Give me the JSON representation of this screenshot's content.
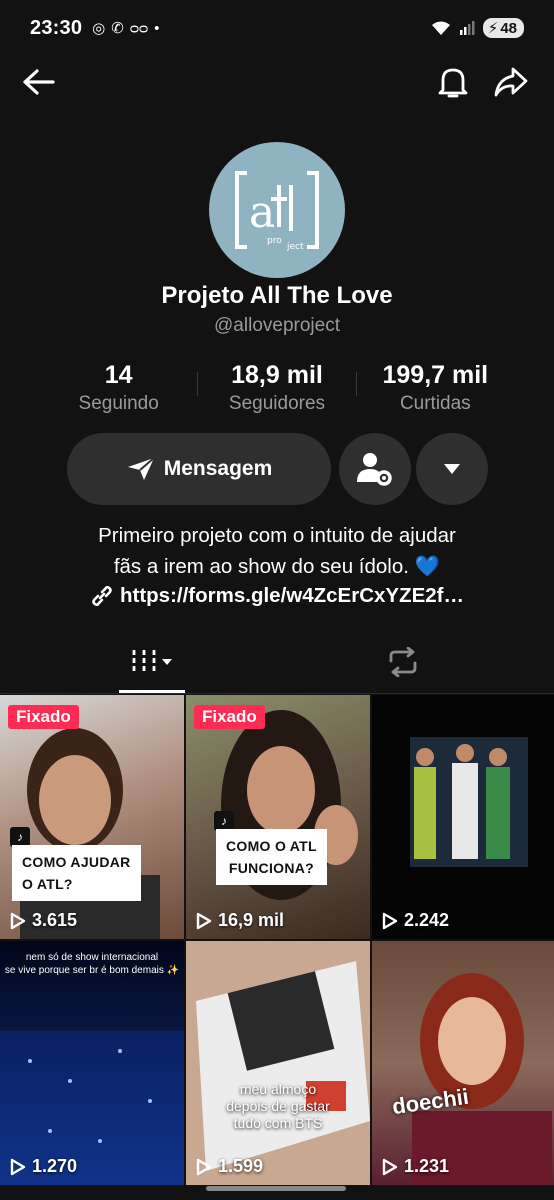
{
  "status_bar": {
    "time": "23:30",
    "battery": "48"
  },
  "profile": {
    "display_name": "Projeto All The Love",
    "username": "@alloveproject",
    "avatar_text": "[atl] project"
  },
  "stats": [
    {
      "value": "14",
      "label": "Seguindo"
    },
    {
      "value": "18,9 mil",
      "label": "Seguidores"
    },
    {
      "value": "199,7 mil",
      "label": "Curtidas"
    }
  ],
  "actions": {
    "message_label": "Mensagem"
  },
  "bio": {
    "line1": "Primeiro projeto com o intuito de ajudar",
    "line2": "fãs a irem ao show do seu ídolo. 💙",
    "link": "https://forms.gle/w4ZcErCxYZE2f…"
  },
  "videos": [
    {
      "pinned": "Fixado",
      "caption": "COMO AJUDAR\nO ATL?",
      "views": "3.615"
    },
    {
      "pinned": "Fixado",
      "caption": "COMO O ATL\nFUNCIONA?",
      "views": "16,9 mil"
    },
    {
      "views": "2.242"
    },
    {
      "overlay": "nem só de show internacional\nse vive porque ser br é bom demais ✨",
      "views": "1.270"
    },
    {
      "overlay": "meu almoço\ndepois de gastar\ntudo com BTS",
      "views": "1.599"
    },
    {
      "overlay": "doechii",
      "views": "1.231"
    }
  ],
  "colors": {
    "background": "#121212",
    "pinned": "#fe2c55",
    "button": "#2f2f2f",
    "secondary_text": "#9a9a9a"
  }
}
